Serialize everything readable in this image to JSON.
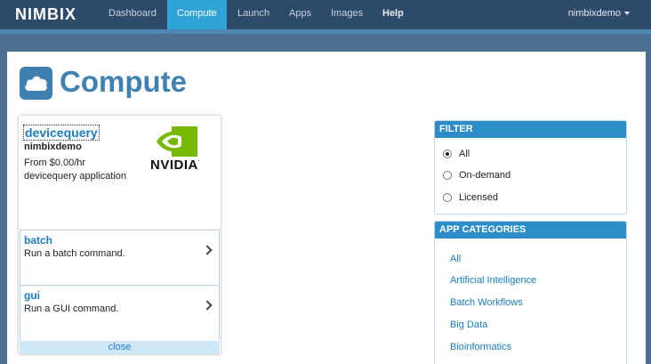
{
  "nav": {
    "logo": "NIMBIX",
    "items": [
      {
        "label": "Dashboard"
      },
      {
        "label": "Compute"
      },
      {
        "label": "Launch"
      },
      {
        "label": "Apps"
      },
      {
        "label": "Images"
      },
      {
        "label": "Help"
      }
    ],
    "active": "Compute",
    "user": "nimbixdemo"
  },
  "page": {
    "title": "Compute",
    "title_icon": "cloud-icon"
  },
  "app_card": {
    "name": "devicequery",
    "owner": "nimbixdemo",
    "price": "From $0.00/hr",
    "description": "devicequery application",
    "vendor_logo_text": "NVIDIA",
    "commands": [
      {
        "name": "batch",
        "description": "Run a batch command."
      },
      {
        "name": "gui",
        "description": "Run a GUI command."
      }
    ],
    "close_label": "close"
  },
  "filter": {
    "heading": "FILTER",
    "options": [
      {
        "label": "All",
        "checked": true
      },
      {
        "label": "On-demand",
        "checked": false
      },
      {
        "label": "Licensed",
        "checked": false
      }
    ]
  },
  "categories": {
    "heading": "APP CATEGORIES",
    "items": [
      "All",
      "Artificial Intelligence",
      "Batch Workflows",
      "Big Data",
      "Bioinformatics"
    ]
  },
  "colors": {
    "nav_bg": "#2d4a6b",
    "nav_active": "#2fa3d6",
    "accent": "#3f82b2",
    "link": "#1a7cc1",
    "nvidia_green": "#76b900"
  }
}
